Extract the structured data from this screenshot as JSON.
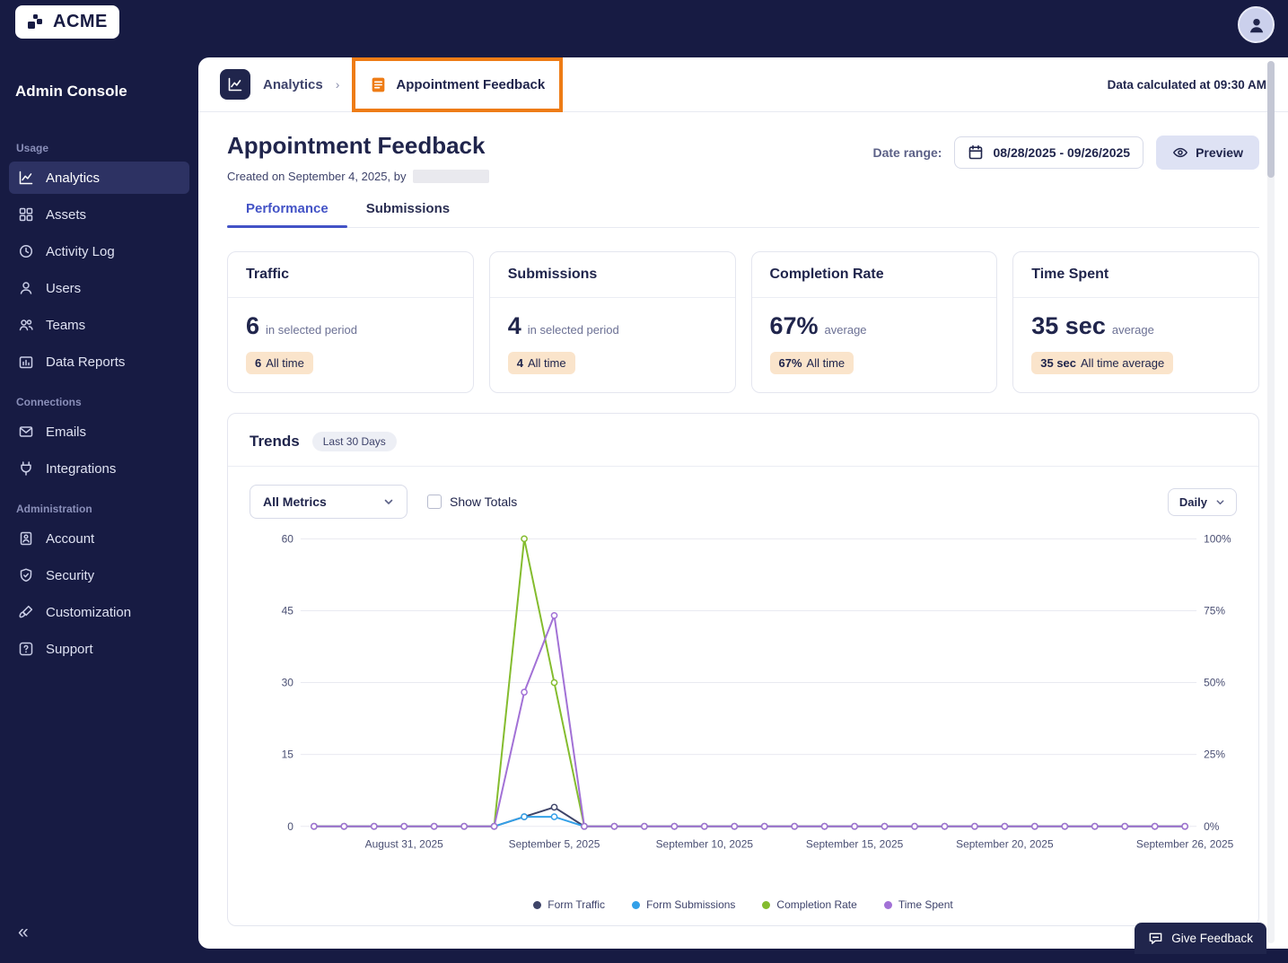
{
  "sidebar": {
    "logo_text": "ACME",
    "title": "Admin Console",
    "collapse_glyph": "«",
    "sections": [
      {
        "label": "Usage",
        "items": [
          {
            "label": "Analytics",
            "active": true
          },
          {
            "label": "Assets"
          },
          {
            "label": "Activity Log"
          },
          {
            "label": "Users"
          },
          {
            "label": "Teams"
          },
          {
            "label": "Data Reports"
          }
        ]
      },
      {
        "label": "Connections",
        "items": [
          {
            "label": "Emails"
          },
          {
            "label": "Integrations"
          }
        ]
      },
      {
        "label": "Administration",
        "items": [
          {
            "label": "Account"
          },
          {
            "label": "Security"
          },
          {
            "label": "Customization"
          },
          {
            "label": "Support"
          }
        ]
      }
    ]
  },
  "header": {
    "breadcrumb_parent": "Analytics",
    "breadcrumb_separator": "›",
    "breadcrumb_current": "Appointment Feedback",
    "data_calculated": "Data calculated at 09:30 AM"
  },
  "page": {
    "title": "Appointment Feedback",
    "created_text": "Created on September 4, 2025, by",
    "date_range_label": "Date range:",
    "date_range_value": "08/28/2025 - 09/26/2025",
    "preview_label": "Preview"
  },
  "tabs": [
    {
      "label": "Performance",
      "active": true
    },
    {
      "label": "Submissions",
      "active": false
    }
  ],
  "stats": [
    {
      "title": "Traffic",
      "value": "6",
      "caption": "in selected period",
      "badge_value": "6",
      "badge_text": "All time"
    },
    {
      "title": "Submissions",
      "value": "4",
      "caption": "in selected period",
      "badge_value": "4",
      "badge_text": "All time"
    },
    {
      "title": "Completion Rate",
      "value": "67%",
      "caption": "average",
      "badge_value": "67%",
      "badge_text": "All time"
    },
    {
      "title": "Time Spent",
      "value": "35 sec",
      "caption": "average",
      "badge_value": "35 sec",
      "badge_text": "All time average"
    }
  ],
  "trends": {
    "title": "Trends",
    "period_pill": "Last 30 Days",
    "metrics_dropdown_value": "All Metrics",
    "show_totals_label": "Show Totals",
    "show_totals_checked": false,
    "interval_dropdown_value": "Daily"
  },
  "feedback_button_label": "Give Feedback",
  "colors": {
    "sidebar_bg": "#171B43",
    "highlight_orange": "#EE7C16",
    "active_tab": "#4353C6",
    "badge_bg": "#FAE4CB",
    "preview_btn_bg": "#DEE2F4"
  },
  "chart_data": {
    "type": "line",
    "title": "Trends",
    "x": [
      "08/28/2025",
      "08/29/2025",
      "08/30/2025",
      "08/31/2025",
      "09/01/2025",
      "09/02/2025",
      "09/03/2025",
      "09/04/2025",
      "09/05/2025",
      "09/06/2025",
      "09/07/2025",
      "09/08/2025",
      "09/09/2025",
      "09/10/2025",
      "09/11/2025",
      "09/12/2025",
      "09/13/2025",
      "09/14/2025",
      "09/15/2025",
      "09/16/2025",
      "09/17/2025",
      "09/18/2025",
      "09/19/2025",
      "09/20/2025",
      "09/21/2025",
      "09/22/2025",
      "09/23/2025",
      "09/24/2025",
      "09/25/2025",
      "09/26/2025"
    ],
    "series": [
      {
        "name": "Form Traffic",
        "color": "#3E4468",
        "axis": "left",
        "values": [
          0,
          0,
          0,
          0,
          0,
          0,
          0,
          2,
          4,
          0,
          0,
          0,
          0,
          0,
          0,
          0,
          0,
          0,
          0,
          0,
          0,
          0,
          0,
          0,
          0,
          0,
          0,
          0,
          0,
          0
        ]
      },
      {
        "name": "Form Submissions",
        "color": "#33A0E8",
        "axis": "left",
        "values": [
          0,
          0,
          0,
          0,
          0,
          0,
          0,
          2,
          2,
          0,
          0,
          0,
          0,
          0,
          0,
          0,
          0,
          0,
          0,
          0,
          0,
          0,
          0,
          0,
          0,
          0,
          0,
          0,
          0,
          0
        ]
      },
      {
        "name": "Completion Rate",
        "color": "#84BC2E",
        "axis": "right",
        "values": [
          0,
          0,
          0,
          0,
          0,
          0,
          0,
          100,
          50,
          0,
          0,
          0,
          0,
          0,
          0,
          0,
          0,
          0,
          0,
          0,
          0,
          0,
          0,
          0,
          0,
          0,
          0,
          0,
          0,
          0
        ]
      },
      {
        "name": "Time Spent",
        "color": "#A271D6",
        "axis": "left",
        "values": [
          0,
          0,
          0,
          0,
          0,
          0,
          0,
          28,
          44,
          0,
          0,
          0,
          0,
          0,
          0,
          0,
          0,
          0,
          0,
          0,
          0,
          0,
          0,
          0,
          0,
          0,
          0,
          0,
          0,
          0
        ]
      }
    ],
    "ylim_left": [
      0,
      60
    ],
    "ylim_right_percent": [
      0,
      100
    ],
    "yticks_left": [
      0,
      15,
      30,
      45,
      60
    ],
    "yticks_right": [
      "0%",
      "25%",
      "50%",
      "75%",
      "100%"
    ],
    "xticks": [
      {
        "index": 3,
        "label": "August 31, 2025"
      },
      {
        "index": 8,
        "label": "September 5, 2025"
      },
      {
        "index": 13,
        "label": "September 10, 2025"
      },
      {
        "index": 18,
        "label": "September 15, 2025"
      },
      {
        "index": 23,
        "label": "September 20, 2025"
      },
      {
        "index": 29,
        "label": "September 26, 2025"
      }
    ],
    "grid": true,
    "legend_position": "bottom"
  }
}
